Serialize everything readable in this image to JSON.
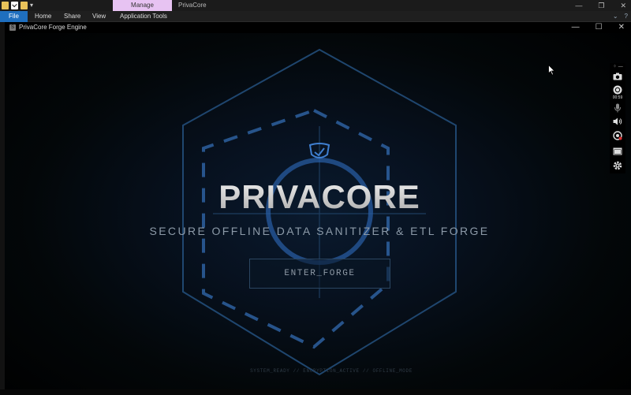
{
  "explorer": {
    "manage_tab": "Manage",
    "window_title": "PrivaCore",
    "ribbon_tabs": [
      "File",
      "Home",
      "Share",
      "View",
      "Application Tools"
    ],
    "controls": {
      "minimize": "—",
      "restore": "❐",
      "close": "✕"
    },
    "ribbon_right": {
      "collapse": "⌄",
      "help": "?"
    }
  },
  "app": {
    "title": "PrivaCore Forge Engine",
    "controls": {
      "minimize": "—",
      "maximize": "☐",
      "close": "✕"
    },
    "brand": "PRIVACORE",
    "tagline": "SECURE OFFLINE DATA SANITIZER & ETL FORGE",
    "enter_button": "ENTER_FORGE",
    "status": "SYSTEM_READY // ENCRYPTION_ACTIVE // OFFLINE_MODE"
  },
  "capture_toolbar": {
    "timer": "00:59",
    "tools": [
      "camera-icon",
      "record-icon",
      "microphone-icon",
      "speaker-icon",
      "webcam-icon",
      "window-icon",
      "settings-icon"
    ]
  },
  "colors": {
    "accent_blue": "#1f6fbf",
    "manage_tab": "#e7c3f2",
    "hex_line": "#2a5b92",
    "dash_line": "#2f65a8"
  }
}
